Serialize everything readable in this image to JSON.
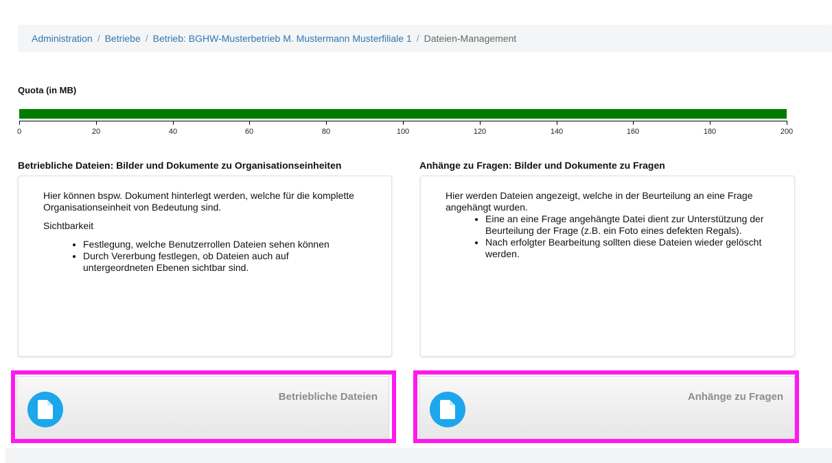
{
  "breadcrumb": {
    "items": [
      "Administration",
      "Betriebe",
      "Betrieb: BGHW-Musterbetrieb M. Mustermann Musterfiliale 1"
    ],
    "separator": "/",
    "current": "Dateien-Management"
  },
  "quota": {
    "title": "Quota (in MB)",
    "used_fraction": 1.0,
    "bar_color": "#007d00",
    "scale_max": 200,
    "ticks": [
      "0",
      "20",
      "40",
      "60",
      "80",
      "100",
      "120",
      "140",
      "160",
      "180",
      "200"
    ]
  },
  "sections": {
    "company": {
      "title": "Betriebliche Dateien: Bilder und Dokumente zu Organisationseinheiten",
      "intro": "Hier können bspw. Dokument hinterlegt werden, welche für die komplette Organisationseinheit von Bedeutung sind.",
      "visibility_heading": "Sichtbarkeit",
      "bullets": [
        "Festlegung, welche Benutzerrollen Dateien sehen können",
        "Durch Vererbung festlegen, ob Dateien auch auf untergeordneten Ebenen sichtbar sind."
      ],
      "tile_label": "Betriebliche Dateien",
      "tile_icon": "file-icon"
    },
    "attachments": {
      "title": "Anhänge zu Fragen: Bilder und Dokumente zu Fragen",
      "intro": "Hier werden Dateien angezeigt, welche in der Beurteilung an eine Frage angehängt wurden.",
      "bullets": [
        "Eine an eine Frage angehängte Datei dient zur Unterstützung der Beurteilung der Frage (z.B. ein Foto eines defekten Regals).",
        "Nach erfolgter Bearbeitung sollten diese Dateien wieder gelöscht werden."
      ],
      "tile_label": "Anhänge zu Fragen",
      "tile_icon": "file-icon"
    }
  },
  "colors": {
    "accent_link": "#3276b1",
    "icon_circle": "#1ca7ec",
    "highlight": "#ff19ee"
  }
}
